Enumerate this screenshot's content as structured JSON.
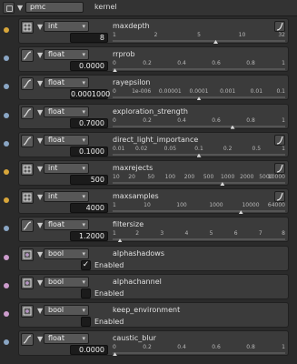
{
  "header": {
    "name": "pmc",
    "label": "kernel"
  },
  "rows": [
    {
      "type": "int",
      "name": "maxdepth",
      "icon": "grid-icon",
      "dot": "yellow",
      "value": "8",
      "curve": true,
      "ticks": [
        {
          "t": "1"
        },
        {
          "t": "2"
        },
        {
          "t": "5"
        },
        {
          "t": "10"
        },
        {
          "t": "32"
        }
      ],
      "marker": 0.6
    },
    {
      "type": "float",
      "name": "rrprob",
      "icon": "curve-icon",
      "dot": "blue",
      "value": "0.0000",
      "curve": false,
      "ticks": [
        {
          "t": "0"
        },
        {
          "t": "0.2"
        },
        {
          "t": "0.4"
        },
        {
          "t": "0.6"
        },
        {
          "t": "0.8"
        },
        {
          "t": "1"
        }
      ],
      "marker": 0.0
    },
    {
      "type": "float",
      "name": "rayepsilon",
      "icon": "curve-icon",
      "dot": "blue",
      "value": "0.0001000",
      "curve": false,
      "ticks": [
        {
          "t": "0"
        },
        {
          "t": "1e-006"
        },
        {
          "t": "0.00001"
        },
        {
          "t": "0.0001"
        },
        {
          "t": "0.001"
        },
        {
          "t": "0.01"
        },
        {
          "t": "0.1"
        }
      ],
      "marker": 0.5
    },
    {
      "type": "float",
      "name": "exploration_strength",
      "icon": "curve-icon",
      "dot": "blue",
      "value": "0.7000",
      "curve": false,
      "ticks": [
        {
          "t": "0"
        },
        {
          "t": "0.2"
        },
        {
          "t": "0.4"
        },
        {
          "t": "0.6"
        },
        {
          "t": "0.8"
        },
        {
          "t": "1"
        }
      ],
      "marker": 0.7
    },
    {
      "type": "float",
      "name": "direct_light_importance",
      "icon": "curve-icon",
      "dot": "blue",
      "value": "0.1000",
      "curve": true,
      "ticks": [
        {
          "t": "0.01"
        },
        {
          "t": "0.02"
        },
        {
          "t": "0.05"
        },
        {
          "t": "0.1"
        },
        {
          "t": "0.2"
        },
        {
          "t": "0.5"
        },
        {
          "t": "1"
        }
      ],
      "marker": 0.5
    },
    {
      "type": "int",
      "name": "maxrejects",
      "icon": "grid-icon",
      "dot": "yellow",
      "value": "500",
      "curve": true,
      "ticks": [
        {
          "t": "10"
        },
        {
          "t": "20"
        },
        {
          "t": "50"
        },
        {
          "t": "100"
        },
        {
          "t": "200"
        },
        {
          "t": "500"
        },
        {
          "t": "1000"
        },
        {
          "t": "2000"
        },
        {
          "t": "5000"
        },
        {
          "t": "10000"
        }
      ],
      "marker": 0.64
    },
    {
      "type": "int",
      "name": "maxsamples",
      "icon": "grid-icon",
      "dot": "yellow",
      "value": "4000",
      "curve": true,
      "ticks": [
        {
          "t": "1"
        },
        {
          "t": "10"
        },
        {
          "t": "100"
        },
        {
          "t": "1000"
        },
        {
          "t": "10000"
        },
        {
          "t": "64000"
        }
      ],
      "marker": 0.75
    },
    {
      "type": "float",
      "name": "filtersize",
      "icon": "curve-icon",
      "dot": "blue",
      "value": "1.2000",
      "curve": false,
      "ticks": [
        {
          "t": "1"
        },
        {
          "t": "2"
        },
        {
          "t": "3"
        },
        {
          "t": "4"
        },
        {
          "t": "5"
        },
        {
          "t": "6"
        },
        {
          "t": "7"
        },
        {
          "t": "8"
        }
      ],
      "marker": 0.03
    },
    {
      "type": "bool",
      "name": "alphashadows",
      "icon": "toggle-icon",
      "dot": "pink",
      "checked": true,
      "label": "Enabled"
    },
    {
      "type": "bool",
      "name": "alphachannel",
      "icon": "toggle-icon",
      "dot": "pink",
      "checked": false,
      "label": "Enabled"
    },
    {
      "type": "bool",
      "name": "keep_environment",
      "icon": "toggle-icon",
      "dot": "pink",
      "checked": false,
      "label": "Enabled"
    },
    {
      "type": "float",
      "name": "caustic_blur",
      "icon": "curve-icon",
      "dot": "blue",
      "value": "0.0000",
      "curve": false,
      "ticks": [
        {
          "t": "0"
        },
        {
          "t": "0.2"
        },
        {
          "t": "0.4"
        },
        {
          "t": "0.6"
        },
        {
          "t": "0.8"
        },
        {
          "t": "1"
        }
      ],
      "marker": 0.0
    }
  ]
}
